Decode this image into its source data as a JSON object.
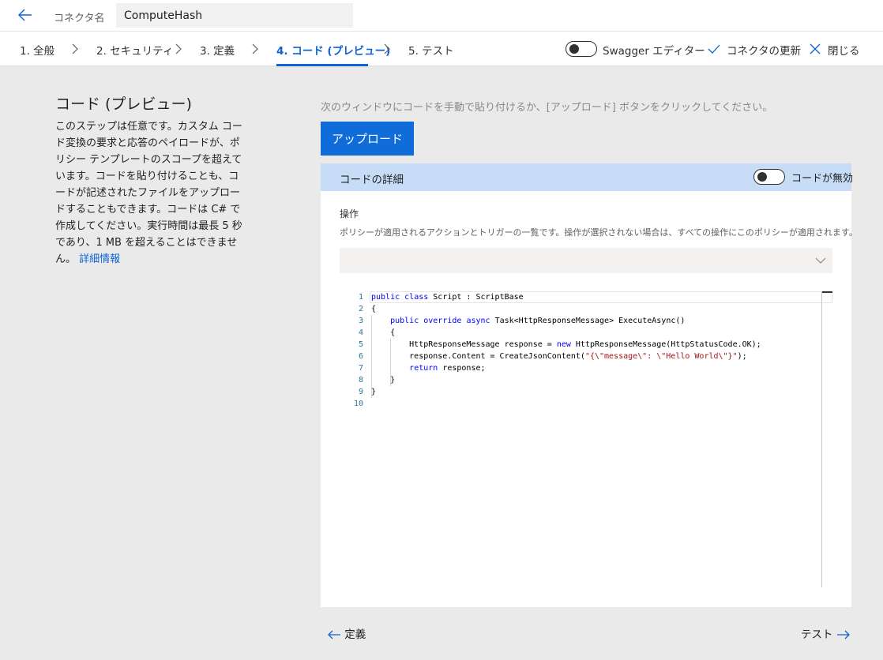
{
  "header": {
    "connector_label": "コネクタ名",
    "connector_name": "ComputeHash"
  },
  "steps": [
    {
      "label": "1. 全般"
    },
    {
      "label": "2. セキュリティ"
    },
    {
      "label": "3. 定義"
    },
    {
      "label": "4. コード (プレビュー)",
      "active": true
    },
    {
      "label": "5. テスト"
    }
  ],
  "actions": {
    "swagger_label": "Swagger エディター",
    "swagger_on": false,
    "update_label": "コネクタの更新",
    "close_label": "閉じる"
  },
  "left": {
    "title": "コード (プレビュー)",
    "description": "このステップは任意です。カスタム コード変換の要求と応答のペイロードが、ポリシー テンプレートのスコープを超えています。コードを貼り付けることも、コードが記述されたファイルをアップロードすることもできます。コードは C# で作成してください。実行時間は最長 5 秒であり、1 MB を超えることはできません。",
    "link": "詳細情報"
  },
  "main": {
    "instruction": "次のウィンドウにコードを手動で貼り付けるか、[アップロード] ボタンをクリックしてください。",
    "upload_label": "アップロード",
    "panel_title": "コードの詳細",
    "code_toggle_label": "コードが無効",
    "code_enabled": false,
    "operations_label": "操作",
    "operations_desc": "ポリシーが適用されるアクションとトリガーの一覧です。操作が選択されない場合は、すべての操作にこのポリシーが適用されます。",
    "operations_value": ""
  },
  "editor": {
    "lines": [
      "public class Script : ScriptBase",
      "{",
      "    public override async Task<HttpResponseMessage> ExecuteAsync()",
      "    {",
      "        HttpResponseMessage response = new HttpResponseMessage(HttpStatusCode.OK);",
      "        response.Content = CreateJsonContent(\"{\\\"message\\\": \\\"Hello World\\\"}\");",
      "        return response;",
      "    }",
      "}",
      ""
    ]
  },
  "footer": {
    "prev_label": "定義",
    "next_label": "テスト"
  },
  "colors": {
    "accent": "#0f62d6",
    "panel_header": "#c7dcf7",
    "background": "#eaeaea"
  },
  "icons": [
    "back-arrow-icon",
    "chevron-right-icon",
    "checkmark-icon",
    "close-icon",
    "chevron-down-icon",
    "arrow-left-icon",
    "arrow-right-icon"
  ]
}
